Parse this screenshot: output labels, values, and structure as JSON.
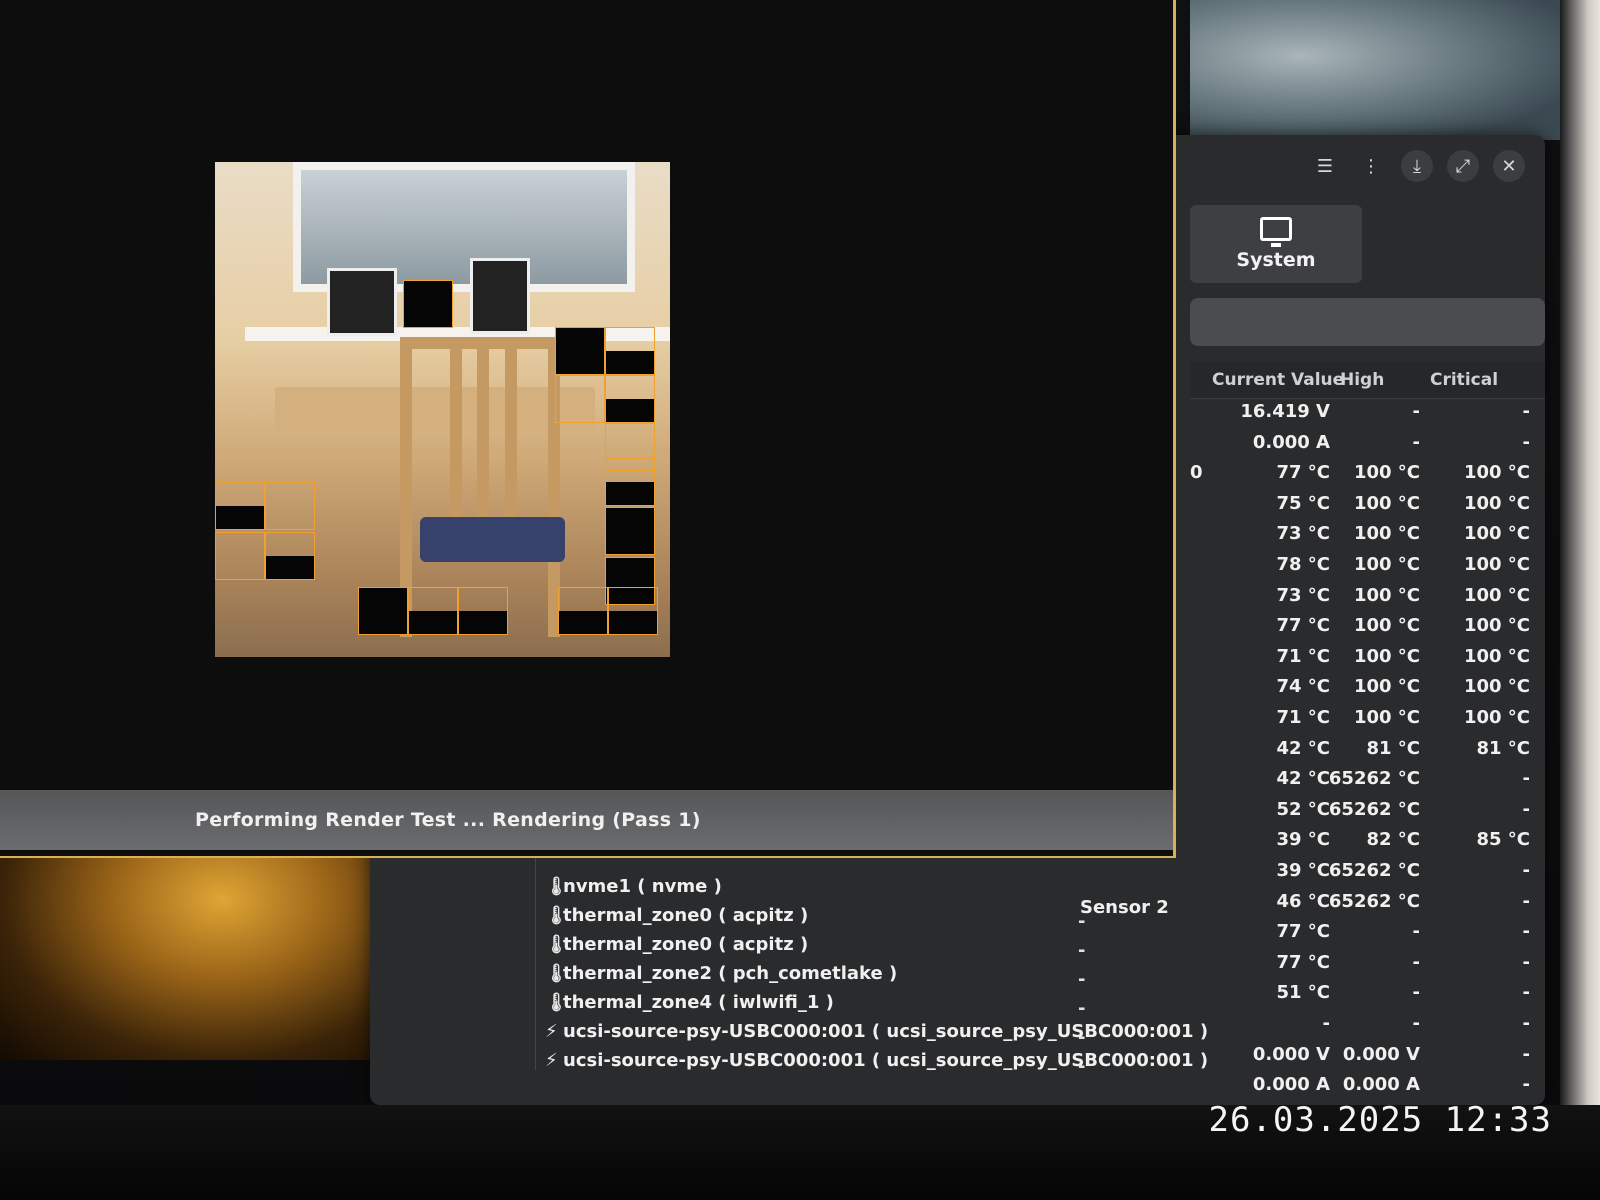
{
  "render_test": {
    "status_text": "Performing Render Test ... Rendering (Pass 1)"
  },
  "sensor_window": {
    "toolbar": {
      "icons": [
        "menu-list-icon",
        "kebab-menu-icon",
        "download-icon",
        "maximize-icon",
        "close-icon"
      ]
    },
    "tab": {
      "label": "System",
      "icon": "monitor-icon"
    },
    "columns": {
      "current_value": "Current Value",
      "high": "High",
      "critical": "Critical"
    },
    "rows": [
      {
        "current": "16.419 V",
        "high": "-",
        "critical": "-"
      },
      {
        "current": "0.000 A",
        "high": "-",
        "critical": "-"
      },
      {
        "current": "77 °C",
        "high": "100 °C",
        "critical": "100 °C",
        "prefix": "0"
      },
      {
        "current": "75 °C",
        "high": "100 °C",
        "critical": "100 °C"
      },
      {
        "current": "73 °C",
        "high": "100 °C",
        "critical": "100 °C"
      },
      {
        "current": "78 °C",
        "high": "100 °C",
        "critical": "100 °C"
      },
      {
        "current": "73 °C",
        "high": "100 °C",
        "critical": "100 °C"
      },
      {
        "current": "77 °C",
        "high": "100 °C",
        "critical": "100 °C"
      },
      {
        "current": "71 °C",
        "high": "100 °C",
        "critical": "100 °C"
      },
      {
        "current": "74 °C",
        "high": "100 °C",
        "critical": "100 °C"
      },
      {
        "current": "71 °C",
        "high": "100 °C",
        "critical": "100 °C"
      },
      {
        "current": "42 °C",
        "high": "81 °C",
        "critical": "81 °C"
      },
      {
        "current": "42 °C",
        "high": "65262 °C",
        "critical": "-"
      },
      {
        "current": "52 °C",
        "high": "65262 °C",
        "critical": "-"
      },
      {
        "current": "39 °C",
        "high": "82 °C",
        "critical": "85 °C"
      },
      {
        "current": "39 °C",
        "high": "65262 °C",
        "critical": "-"
      },
      {
        "current": "46 °C",
        "high": "65262 °C",
        "critical": "-"
      },
      {
        "current": "77 °C",
        "high": "-",
        "critical": "-"
      },
      {
        "current": "77 °C",
        "high": "-",
        "critical": "-"
      },
      {
        "current": "51 °C",
        "high": "-",
        "critical": "-"
      },
      {
        "current": "-",
        "high": "-",
        "critical": "-"
      },
      {
        "current": "0.000 V",
        "high": "0.000 V",
        "critical": "-"
      },
      {
        "current": "0.000 A",
        "high": "0.000 A",
        "critical": "-"
      }
    ],
    "sensors": [
      {
        "name": "nvme1 ( nvme )",
        "icon": "thermometer-icon",
        "label": ""
      },
      {
        "name": "thermal_zone0 ( acpitz )",
        "icon": "thermometer-icon",
        "label": "Sensor 2",
        "dash": "-"
      },
      {
        "name": "thermal_zone0 ( acpitz )",
        "icon": "thermometer-icon",
        "label": "",
        "dash": "-"
      },
      {
        "name": "thermal_zone2 ( pch_cometlake )",
        "icon": "thermometer-icon",
        "label": "",
        "dash": "-"
      },
      {
        "name": "thermal_zone4 ( iwlwifi_1 )",
        "icon": "thermometer-icon",
        "label": "",
        "dash": "-"
      },
      {
        "name": "ucsi-source-psy-USBC000:001 ( ucsi_source_psy_USBC000:001 )",
        "icon": "lightning-icon",
        "label": "",
        "dash": "-"
      },
      {
        "name": "ucsi-source-psy-USBC000:001 ( ucsi_source_psy_USBC000:001 )",
        "icon": "lightning-icon",
        "label": "",
        "dash": "-"
      }
    ]
  },
  "photo_overlay": {
    "timestamp": "26.03.2025 12:33"
  },
  "colors": {
    "accent_border": "#d9b055",
    "tile_outline": "#f0a030",
    "window_bg": "#2a2b2d"
  }
}
